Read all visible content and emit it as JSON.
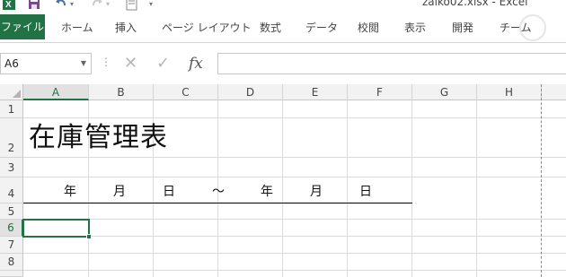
{
  "window": {
    "title": "zaiko02.xlsx - Excel"
  },
  "quick_access": {
    "excel_logo_icon": "excel-logo",
    "save_icon": "save",
    "undo_icon": "undo",
    "redo_icon": "redo",
    "doc_icon": "new-document",
    "customize_icon": "customize-qat"
  },
  "ribbon": {
    "tabs": [
      {
        "label": "ファイル"
      },
      {
        "label": "ホーム"
      },
      {
        "label": "挿入"
      },
      {
        "label": "ページ レイアウト"
      },
      {
        "label": "数式"
      },
      {
        "label": "データ"
      },
      {
        "label": "校閲"
      },
      {
        "label": "表示"
      },
      {
        "label": "開発"
      },
      {
        "label": "チーム"
      }
    ],
    "accent_color": "#217346"
  },
  "formula_bar": {
    "name_box": "A6",
    "fx_label": "fx",
    "formula_value": ""
  },
  "sheet": {
    "columns": [
      "A",
      "B",
      "C",
      "D",
      "E",
      "F",
      "G",
      "H"
    ],
    "rows": [
      "1",
      "2",
      "3",
      "4",
      "5",
      "6",
      "7",
      "8"
    ],
    "active_cell": "A6",
    "cells": {
      "A2": "在庫管理表",
      "row4_labels": [
        "年",
        "月",
        "日",
        "～",
        "年",
        "月",
        "日"
      ]
    }
  }
}
